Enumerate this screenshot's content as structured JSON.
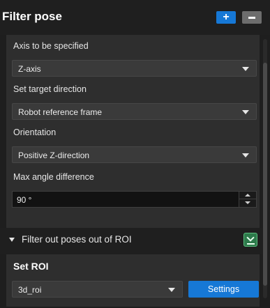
{
  "header": {
    "title": "Filter pose",
    "add_icon": "plus-icon",
    "remove_icon": "minus-icon"
  },
  "fields": {
    "axis": {
      "label": "Axis to be specified",
      "value": "Z-axis"
    },
    "target_direction": {
      "label": "Set target direction",
      "value": "Robot reference frame"
    },
    "orientation": {
      "label": "Orientation",
      "value": "Positive Z-direction"
    },
    "max_angle": {
      "label": "Max angle difference",
      "value": "90 °"
    }
  },
  "section": {
    "label": "Filter out poses out of ROI",
    "icon": "collapse-icon"
  },
  "roi": {
    "title": "Set ROI",
    "value": "3d_roi",
    "settings_label": "Settings"
  },
  "colors": {
    "accent": "#1678d6",
    "toggle_green": "#2d7a4b"
  }
}
